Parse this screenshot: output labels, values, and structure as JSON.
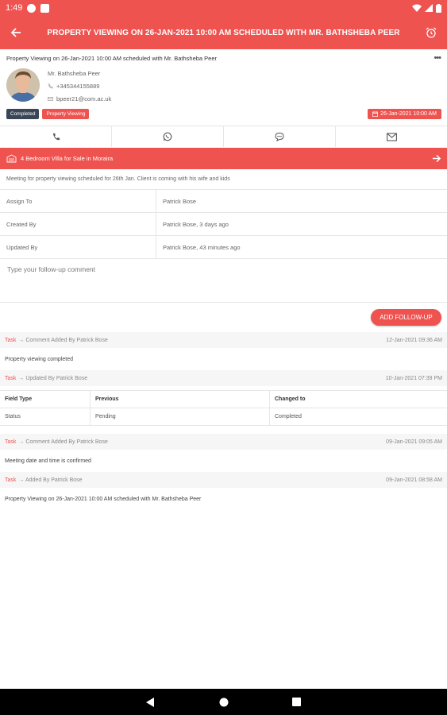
{
  "status_bar": {
    "time": "1:49"
  },
  "app_bar": {
    "title": "PROPERTY VIEWING ON 26-JAN-2021 10:00 AM SCHEDULED WITH MR. BATHSHEBA PEER"
  },
  "summary": {
    "text": "Property Viewing on 26-Jan-2021 10:00 AM scheduled with Mr. Bathsheba Peer",
    "more": "•••"
  },
  "contact": {
    "name": "Mr. Bathsheba Peer",
    "phone": "+345344155889",
    "email": "bpeer21@com.ac.uk"
  },
  "badges": {
    "status": "Completed",
    "type": "Property Viewing",
    "date": "26-Jan-2021 10:00 AM"
  },
  "property": {
    "title": "4 Bedroom Villa for Sale in Moraira"
  },
  "note": "Meeting for property viewing scheduled for 26th Jan. Client is coming with his wife and kids",
  "details": [
    {
      "key": "Assign To",
      "value": "Patrick Bose"
    },
    {
      "key": "Created By",
      "value": "Patrick Bose, 3 days ago"
    },
    {
      "key": "Updated By",
      "value": "Patrick Bose, 43 minutes ago"
    }
  ],
  "comment": {
    "placeholder": "Type your follow-up comment",
    "value": ""
  },
  "follow_up_button": "ADD FOLLOW-UP",
  "feed": {
    "entry1": {
      "tag": "Task",
      "action": "→ Comment Added By Patrick Bose",
      "time": "12-Jan-2021 09:36 AM",
      "body": "Property viewing completed"
    },
    "entry2": {
      "tag": "Task",
      "action": "→ Updated By Patrick Bose",
      "time": "10-Jan-2021 07:39 PM",
      "headers": [
        "Field Type",
        "Previous",
        "Changed to"
      ],
      "row": [
        "Status",
        "Pending",
        "Completed"
      ]
    },
    "entry3": {
      "tag": "Task",
      "action": "→ Comment Added By Patrick Bose",
      "time": "09-Jan-2021 09:05 AM",
      "body": "Meeting date and time is confirmed"
    },
    "entry4": {
      "tag": "Task",
      "action": "→ Added By Patrick Bose",
      "time": "09-Jan-2021 08:58 AM",
      "body": "Property Viewing on 26-Jan-2021 10:00 AM scheduled with Mr. Bathsheba Peer"
    }
  },
  "colors": {
    "accent": "#ef5350",
    "badge_dark": "#3a4656",
    "nav_bg": "#000000"
  },
  "icons": {
    "back": "arrow-left-icon",
    "alarm": "alarm-clock-icon",
    "phone": "phone-icon",
    "whatsapp": "whatsapp-icon",
    "chat": "chat-bubble-icon",
    "mail": "envelope-icon",
    "property": "building-icon",
    "forward": "arrow-right-icon"
  }
}
